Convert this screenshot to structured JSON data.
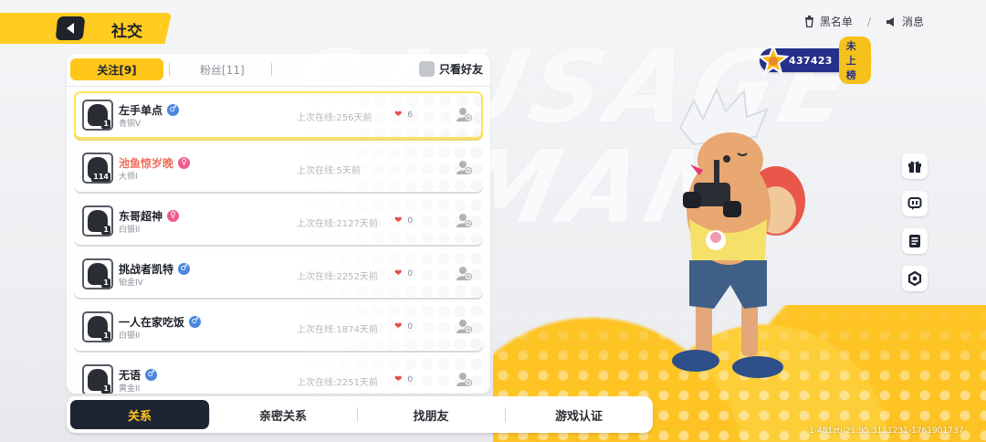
{
  "background": {
    "logo_text_line1": "SAUSAGE",
    "logo_text_line2": "MAN"
  },
  "header": {
    "title": "社交"
  },
  "top_right": {
    "blacklist_label": "黑名单",
    "messages_label": "消息"
  },
  "rank_pill": {
    "score": "437423",
    "status": "未上榜"
  },
  "panel": {
    "tabs": {
      "following": "关注[9]",
      "fans": "粉丝[11]"
    },
    "only_friends_label": "只看好友",
    "rows": [
      {
        "name": "左手单点",
        "gender": "male",
        "rank": "青铜V",
        "level": "1",
        "last_online": "上次在线:256天前",
        "likes": "6",
        "selected": true,
        "vip": false
      },
      {
        "name": "池鱼惊岁晚",
        "gender": "female",
        "rank": "大师I",
        "level": "114",
        "last_online": "上次在线:5天前",
        "likes": "",
        "selected": false,
        "vip": true
      },
      {
        "name": "东哥超神",
        "gender": "female",
        "rank": "白银II",
        "level": "1",
        "last_online": "上次在线:2127天前",
        "likes": "0",
        "selected": false,
        "vip": false
      },
      {
        "name": "挑战者凯特",
        "gender": "male",
        "rank": "铂金IV",
        "level": "1",
        "last_online": "上次在线:2252天前",
        "likes": "0",
        "selected": false,
        "vip": false
      },
      {
        "name": "一人在家吃饭",
        "gender": "male",
        "rank": "白银II",
        "level": "1",
        "last_online": "上次在线:1874天前",
        "likes": "0",
        "selected": false,
        "vip": false
      },
      {
        "name": "无语",
        "gender": "male",
        "rank": "黄金II",
        "level": "1",
        "last_online": "上次在线:2251天前",
        "likes": "0",
        "selected": false,
        "vip": false
      }
    ]
  },
  "bottom_nav": {
    "items": [
      "关系",
      "亲密关系",
      "找朋友",
      "游戏认证"
    ]
  },
  "side_icons": [
    "gift-icon",
    "chat-icon",
    "notes-icon",
    "settings-icon"
  ],
  "build_info": "1-481ztj-21.95.3111231-1761901737",
  "colors": {
    "accent_yellow": "#ffc61a",
    "dark": "#1f2433",
    "rank_blue": "#24308a"
  }
}
